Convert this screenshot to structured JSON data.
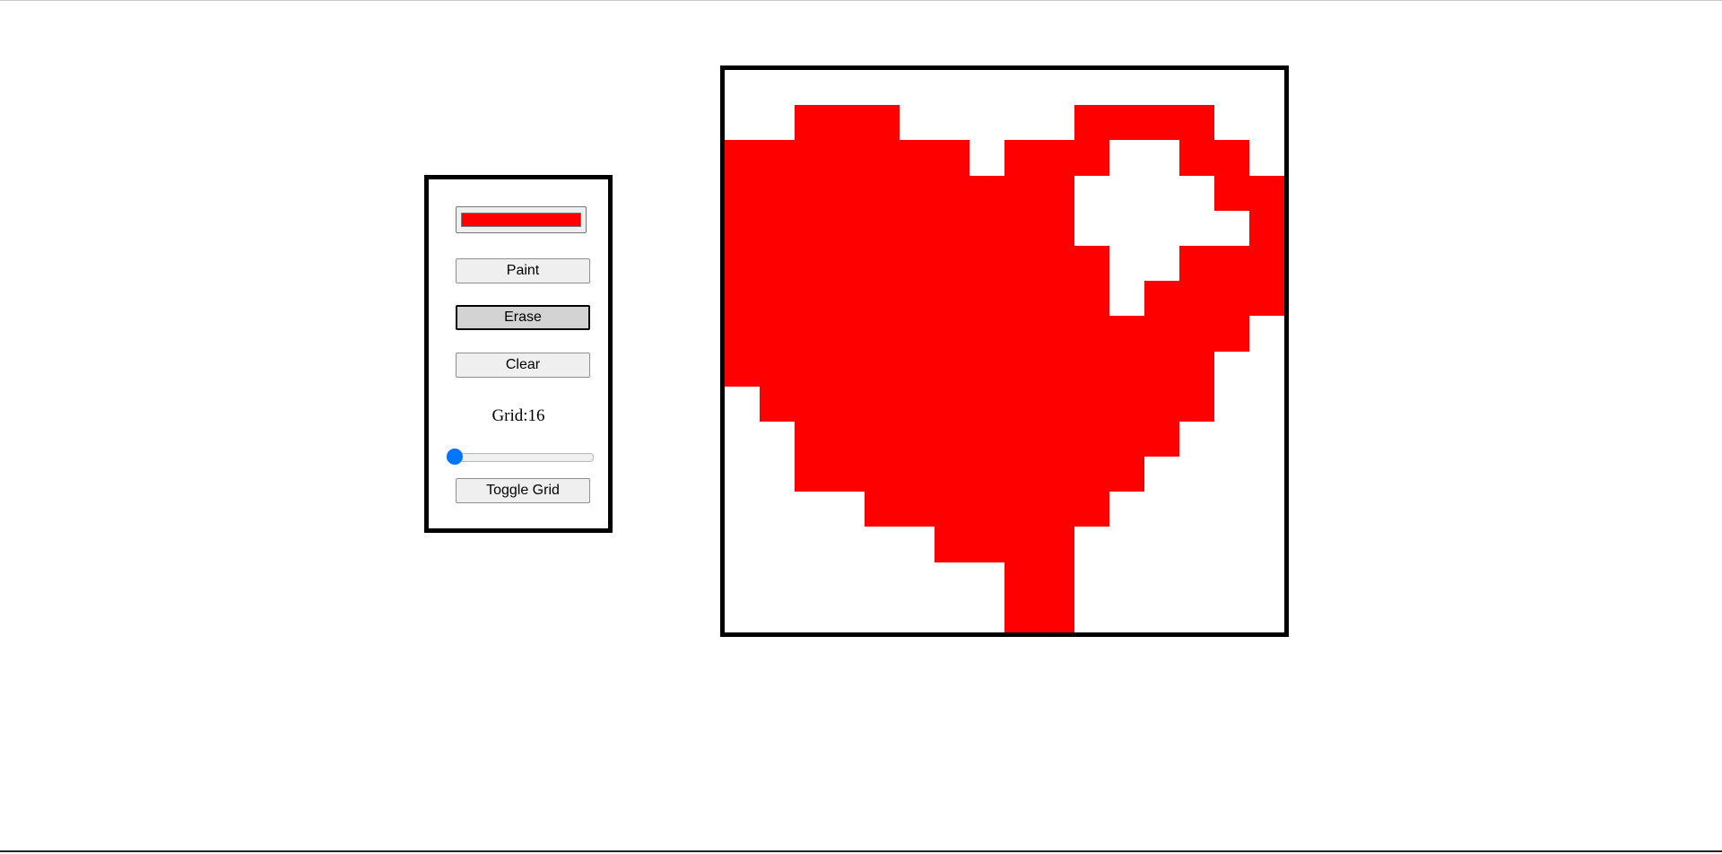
{
  "tools": {
    "color_value": "#ff0000",
    "paint_label": "Paint",
    "erase_label": "Erase",
    "clear_label": "Clear",
    "grid_label": "Grid:16",
    "slider_value": 16,
    "slider_min": 16,
    "slider_max": 100,
    "toggle_grid_label": "Toggle Grid",
    "active_mode": "erase"
  },
  "canvas": {
    "grid_size": 16,
    "paint_color": "#ff0000",
    "empty_color": "#ffffff",
    "rows": [
      "................",
      "..###.....####..",
      "#######.###..##.",
      "##########....##",
      "##########.....#",
      "###########..###",
      "###########.####",
      "###############.",
      "##############..",
      ".#############..",
      "..###########...",
      "..##########....",
      "....#######.....",
      "......####......",
      "........##......",
      "........##......"
    ]
  }
}
